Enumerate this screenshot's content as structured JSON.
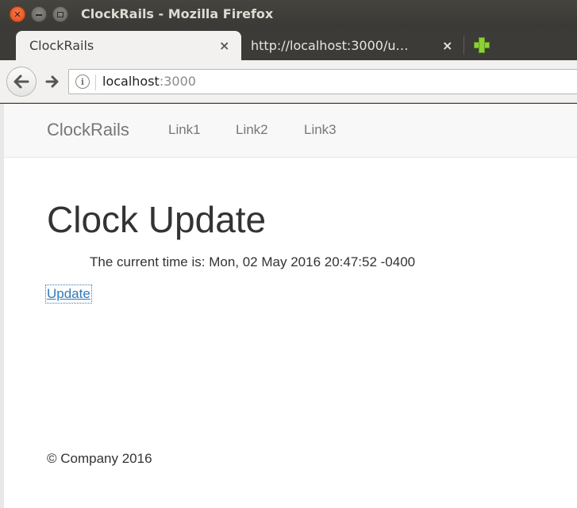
{
  "window": {
    "title": "ClockRails - Mozilla Firefox"
  },
  "tabs": [
    {
      "label": "ClockRails",
      "close": "×"
    },
    {
      "label": "http://localhost:3000/u…",
      "close": "×"
    }
  ],
  "toolbar": {
    "back_icon": "arrow-left-icon",
    "forward_icon": "arrow-right-icon",
    "info_icon": "info-icon",
    "new_tab_icon": "plus-icon"
  },
  "urlbar": {
    "host": "localhost",
    "port": ":3000"
  },
  "site_nav": {
    "brand": "ClockRails",
    "links": [
      "Link1",
      "Link2",
      "Link3"
    ]
  },
  "main": {
    "heading": "Clock Update",
    "time_text": "The current time is: Mon, 02 May 2016 20:47:52 -0400",
    "update_link": "Update"
  },
  "footer": {
    "text": "© Company 2016"
  },
  "colors": {
    "link": "#337ab7",
    "nav_text": "#777777",
    "body_text": "#333333",
    "close_button": "#df4b16",
    "new_tab": "#8fcf3a"
  }
}
